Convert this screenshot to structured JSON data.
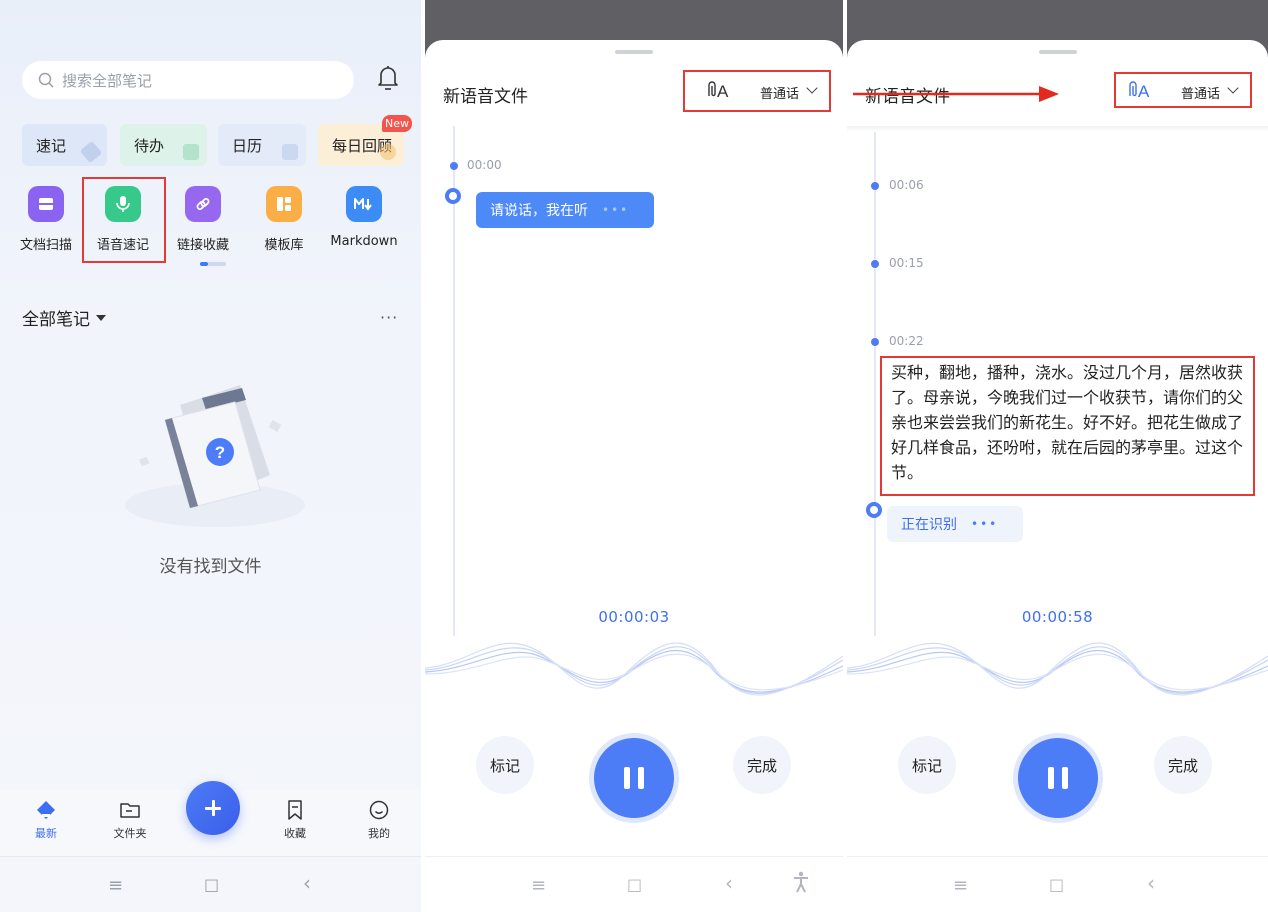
{
  "panel1": {
    "search_placeholder": "搜索全部笔记",
    "quick": [
      {
        "label": "速记",
        "color": "#dde7f7"
      },
      {
        "label": "待办",
        "color": "#ddf2e8"
      },
      {
        "label": "日历",
        "color": "#e4ebf8"
      },
      {
        "label": "每日回顾",
        "color": "#fbefd8"
      }
    ],
    "new_badge": "New",
    "tools": [
      {
        "label": "文档扫描",
        "color": "#8a63f0"
      },
      {
        "label": "语音速记",
        "color": "#37c98a"
      },
      {
        "label": "链接收藏",
        "color": "#9668f0"
      },
      {
        "label": "模板库",
        "color": "#fbae45"
      },
      {
        "label": "Markdown",
        "color": "#3d8cf5"
      }
    ],
    "all_notes": "全部笔记",
    "more": "···",
    "empty_text": "没有找到文件",
    "tabs": [
      "最新",
      "文件夹",
      "收藏",
      "我的"
    ],
    "nav": [
      "≡",
      "□",
      "‹"
    ]
  },
  "panel2": {
    "title": "新语音文件",
    "language": "普通话",
    "timestamp": "00:00",
    "bubble_text": "请说话，我在听",
    "bubble_dots": "•••",
    "timer": "00:00:03",
    "mark_label": "标记",
    "done_label": "完成",
    "nav": [
      "≡",
      "□",
      "‹",
      "🚹"
    ]
  },
  "panel3": {
    "title": "新语音文件",
    "language": "普通话",
    "timestamps": [
      "00:06",
      "00:15",
      "00:22"
    ],
    "transcript": "买种，翻地，播种，浇水。没过几个月，居然收获了。母亲说，今晚我们过一个收获节，请你们的父亲也来尝尝我们的新花生。好不好。把花生做成了好几样食品，还吩咐，就在后园的茅亭里。过这个节。",
    "recognizing": "正在识别",
    "recognizing_dots": "•••",
    "timer": "00:00:58",
    "mark_label": "标记",
    "done_label": "完成",
    "nav": [
      "≡",
      "□",
      "‹"
    ]
  }
}
